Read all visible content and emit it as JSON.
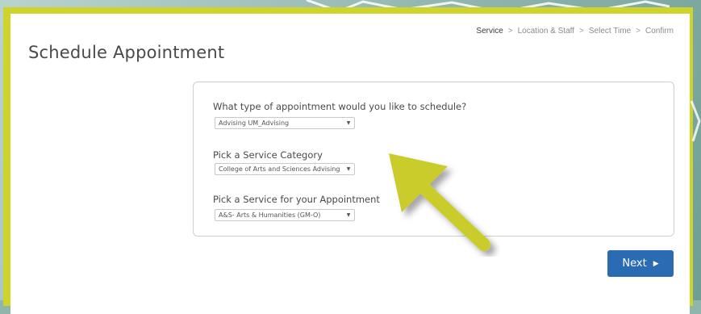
{
  "breadcrumb": {
    "items": [
      "Service",
      "Location & Staff",
      "Select Time",
      "Confirm"
    ],
    "separator": ">",
    "active_index": 0
  },
  "page": {
    "title": "Schedule Appointment"
  },
  "form": {
    "appointment_type": {
      "label": "What type of appointment would you like to schedule?",
      "selected": "Advising UM_Advising"
    },
    "service_category": {
      "label": "Pick a Service Category",
      "selected": "College of Arts and Sciences Advising"
    },
    "service": {
      "label": "Pick a Service for your Appointment",
      "selected": "A&S- Arts & Humanities (GM-O)"
    }
  },
  "actions": {
    "next_label": "Next",
    "next_icon": "caret-right-icon"
  },
  "colors": {
    "frame": "#cfd42c",
    "primary_button": "#2a6bb3",
    "callout_arrow": "#c9cc2a",
    "background": "#8fb5ad"
  }
}
